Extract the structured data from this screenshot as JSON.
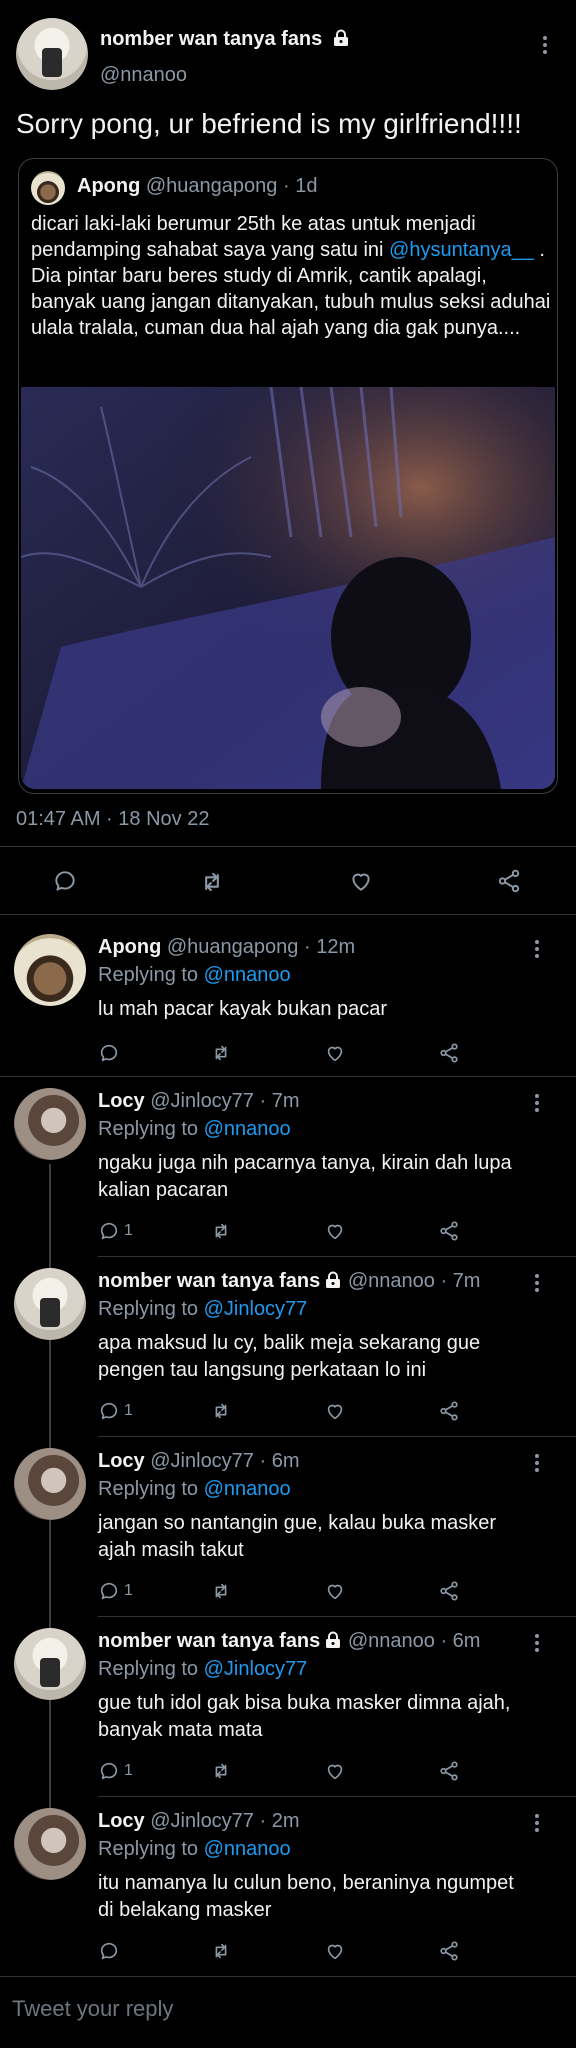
{
  "main_tweet": {
    "author_name": "nomber wan tanya fans",
    "author_handle": "@nnanoo",
    "text": "Sorry pong, ur befriend is my girlfriend!!!!",
    "quoted": {
      "author_name": "Apong",
      "author_handle": "@huangapong",
      "time": "· 1d",
      "text_before_mention": "dicari laki-laki berumur 25th ke atas untuk menjadi pendamping sahabat saya yang satu ini ",
      "mention": "@hysuntanya__",
      "text_after_mention": " . Dia pintar baru beres study di Amrik, cantik apalagi, banyak uang jangan ditanyakan, tubuh mulus seksi aduhai ulala tralala, cuman dua hal ajah yang dia gak punya...."
    },
    "timestamp": "01:47 AM · 18 Nov 22"
  },
  "replies": [
    {
      "name": "Apong",
      "handle": "@huangapong",
      "time": "· 12m",
      "replying_label": "Replying to",
      "replying_to": "@nnanoo",
      "text": "lu mah pacar kayak bukan pacar",
      "reply_count": ""
    },
    {
      "name": "Locy",
      "handle": "@Jinlocy77",
      "time": "· 7m",
      "replying_label": "Replying to",
      "replying_to": "@nnanoo",
      "text": "ngaku juga nih pacarnya tanya, kirain dah lupa kalian pacaran",
      "reply_count": "1"
    },
    {
      "name": "nomber wan tanya fans",
      "handle": "@nnanoo",
      "time": "· 7m",
      "replying_label": "Replying to",
      "replying_to": "@Jinlocy77",
      "text": "apa maksud lu cy, balik meja sekarang gue pengen tau langsung perkataan lo ini",
      "reply_count": "1"
    },
    {
      "name": "Locy",
      "handle": "@Jinlocy77",
      "time": "· 6m",
      "replying_label": "Replying to",
      "replying_to": "@nnanoo",
      "text": "jangan so nantangin gue, kalau buka masker ajah masih takut",
      "reply_count": "1"
    },
    {
      "name": "nomber wan tanya fans",
      "handle": "@nnanoo",
      "time": "· 6m",
      "replying_label": "Replying to",
      "replying_to": "@Jinlocy77",
      "text": "gue tuh idol gak bisa buka masker dimna ajah, banyak mata mata",
      "reply_count": "1"
    },
    {
      "name": "Locy",
      "handle": "@Jinlocy77",
      "time": "· 2m",
      "replying_label": "Replying to",
      "replying_to": "@nnanoo",
      "text": "itu namanya lu culun beno, beraninya ngumpet di belakang masker",
      "reply_count": ""
    }
  ],
  "composer": {
    "placeholder": "Tweet your reply"
  },
  "colors": {
    "background": "#000000",
    "link": "#1d9bf0",
    "muted": "#8b98a5",
    "divider": "#2f3336"
  },
  "icons": [
    "lock-icon",
    "more-options-icon",
    "reply-icon",
    "retweet-icon",
    "like-icon",
    "share-icon"
  ]
}
